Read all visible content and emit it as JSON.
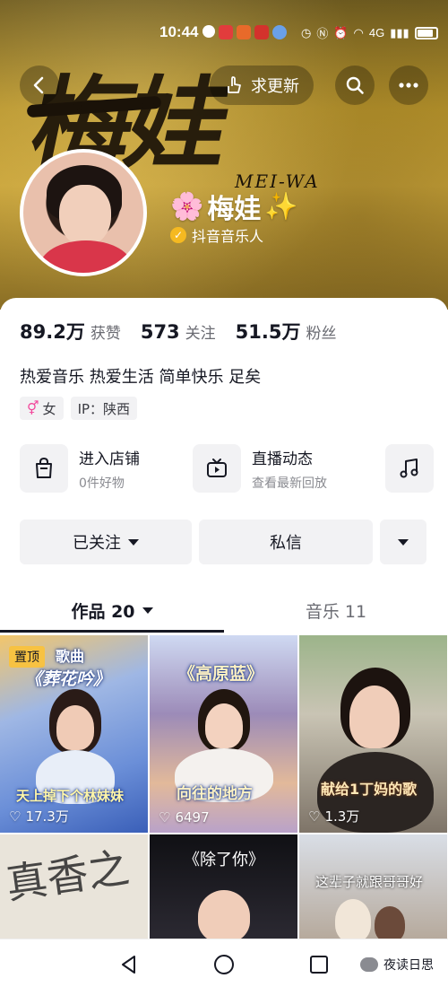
{
  "status_bar": {
    "time": "10:44",
    "network": "4G"
  },
  "header": {
    "calligraphy_title": "梅娃",
    "calligraphy_subtitle": "MEI-WA",
    "update_label": "求更新"
  },
  "profile": {
    "name": "梅娃",
    "name_prefix_emoji": "🌸",
    "name_suffix_emoji": "✨",
    "verification": "抖音音乐人"
  },
  "stats": [
    {
      "value": "89.2万",
      "label": "获赞"
    },
    {
      "value": "573",
      "label": "关注"
    },
    {
      "value": "51.5万",
      "label": "粉丝"
    }
  ],
  "bio": "热爱音乐 热爱生活 简单快乐 足矣",
  "tags": {
    "gender": "女",
    "ip": "IP：陕西"
  },
  "entries": [
    {
      "title": "进入店铺",
      "subtitle": "0件好物"
    },
    {
      "title": "直播动态",
      "subtitle": "查看最新回放"
    },
    {
      "title": "",
      "subtitle": ""
    }
  ],
  "actions": {
    "follow": "已关注",
    "message": "私信"
  },
  "tabs": {
    "works": "作品 20",
    "music": "音乐 11"
  },
  "videos": [
    {
      "pinned": "置顶",
      "caption_top": "歌曲",
      "caption_title": "《葬花吟》",
      "caption_bottom": "天上掉下个林妹妹",
      "likes": "17.3万"
    },
    {
      "caption_title": "《高原蓝》",
      "caption_bottom": "向往的地方",
      "likes": "6497"
    },
    {
      "caption_bottom": "献给1丁妈的歌",
      "likes": "1.3万"
    },
    {
      "caption_title": "",
      "likes": ""
    },
    {
      "caption_title": "《除了你》",
      "likes": ""
    },
    {
      "caption_title": "这辈子就跟哥哥好",
      "likes": ""
    }
  ],
  "watermark": "夜读日思"
}
